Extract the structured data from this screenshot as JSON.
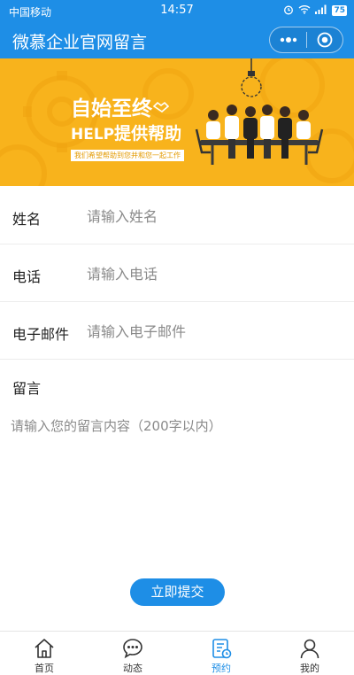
{
  "status_bar": {
    "carrier": "中国移动",
    "time": "14:57",
    "battery": "75"
  },
  "nav": {
    "title": "微慕企业官网留言"
  },
  "banner": {
    "headline": "自始至终",
    "subline_en": "HELP",
    "subline_cn": "提供帮助",
    "tagline": "我们希望帮助到您并和您一起工作"
  },
  "form": {
    "name": {
      "label": "姓名",
      "placeholder": "请输入姓名",
      "value": ""
    },
    "phone": {
      "label": "电话",
      "placeholder": "请输入电话",
      "value": ""
    },
    "email": {
      "label": "电子邮件",
      "placeholder": "请输入电子邮件",
      "value": ""
    },
    "message": {
      "label": "留言",
      "placeholder": "请输入您的留言内容（200字以内）",
      "value": ""
    },
    "submit_label": "立即提交"
  },
  "tabs": [
    {
      "label": "首页",
      "icon": "home-icon",
      "active": false
    },
    {
      "label": "动态",
      "icon": "chat-bubble-icon",
      "active": false
    },
    {
      "label": "预约",
      "icon": "appointment-icon",
      "active": true
    },
    {
      "label": "我的",
      "icon": "user-icon",
      "active": false
    }
  ],
  "colors": {
    "primary": "#1e8ee6",
    "banner_bg": "#f8b31c",
    "divider": "#ececec"
  }
}
